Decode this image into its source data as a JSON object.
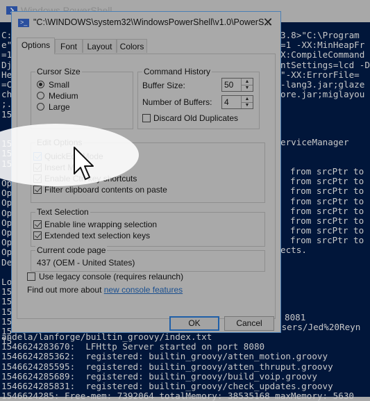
{
  "background_window": {
    "title": "Windows PowerShell",
    "icon": "powershell-icon"
  },
  "console": {
    "left_fragments": [
      "C:",
      "e\"",
      "=1",
      "Dj",
      "He",
      "=C",
      "ch",
      ";.",
      "15",
      "",
      "",
      "15",
      "15",
      "15",
      "",
      "Op",
      "Op",
      "Op",
      "Op",
      "Op",
      "Op",
      "Op",
      "Op",
      "De",
      "",
      "Lo",
      "15",
      "15",
      "15",
      "15",
      "15",
      "15"
    ],
    "right_fragments_top": [
      "3.8>\"C:\\Program",
      "=1 -XX:MinHeapFr",
      "X:CompileCommand",
      "ntSettings=lcd -D",
      "\"-XX:ErrorFile=",
      "-lang3.jar;glaze",
      "ore.jar;miglayou"
    ],
    "right_service": "erviceManager",
    "right_srcptr": [
      "from srcPtr to",
      "from srcPtr to",
      "from srcPtr to",
      "from srcPtr to",
      "from srcPtr to",
      "from srcPtr to",
      "from srcPtr to",
      "from srcPtr to"
    ],
    "right_connects": "ects.",
    "right_port": "8081",
    "right_users": "Users/Jed%20Reyn",
    "bottom_lines": [
      "andela/lanforge/builtin_groovy/index.txt",
      "1546624283670:  LFHttp Server started on port 8080",
      "1546624285362:  registered: builtin_groovy/atten_motion.groovy",
      "1546624285595:  registered: builtin_groovy/atten_thruput.groovy",
      "1546624285689:  registered: builtin_groovy/build_voip.groovy",
      "1546624285831:  registered: builtin_groovy/check_updates.groovy",
      "1546624285: Free-mem: 7392064 totalMemory: 38535168 maxMemory: 5630"
    ]
  },
  "dialog": {
    "title": "\"C:\\WINDOWS\\system32\\WindowsPowerShell\\v1.0\\PowerS...",
    "close_glyph": "✕",
    "tabs": [
      {
        "label": "Options",
        "active": true
      },
      {
        "label": "Font",
        "active": false
      },
      {
        "label": "Layout",
        "active": false
      },
      {
        "label": "Colors",
        "active": false
      }
    ],
    "cursor_size": {
      "label": "Cursor Size",
      "options": [
        {
          "label": "Small",
          "selected": true
        },
        {
          "label": "Medium",
          "selected": false
        },
        {
          "label": "Large",
          "selected": false
        }
      ]
    },
    "command_history": {
      "label": "Command History",
      "buffer_size_label": "Buffer Size:",
      "buffer_size_value": "50",
      "num_buffers_label": "Number of Buffers:",
      "num_buffers_value": "4",
      "discard_label": "Discard Old Duplicates",
      "discard_checked": false
    },
    "edit_options": {
      "label": "Edit Options",
      "items": [
        {
          "label": "QuickEdit Mode",
          "checked": true
        },
        {
          "label": "Insert Mode",
          "checked": true
        },
        {
          "label": "Enable Ctrl key shortcuts",
          "checked": true
        },
        {
          "label": "Filter clipboard contents on paste",
          "checked": true
        }
      ]
    },
    "text_selection": {
      "label": "Text Selection",
      "items": [
        {
          "label": "Enable line wrapping selection",
          "checked": true
        },
        {
          "label": "Extended text selection keys",
          "checked": true
        }
      ]
    },
    "code_page": {
      "label": "Current code page",
      "value": "437   (OEM - United States)"
    },
    "legacy_console": {
      "label": "Use legacy console (requires relaunch)",
      "checked": false
    },
    "find_out_more": "Find out more about ",
    "find_out_link": "new console features",
    "ok_label": "OK",
    "cancel_label": "Cancel",
    "spin_up": "▲",
    "spin_down": "▼"
  },
  "colors": {
    "console_bg": "#01163a",
    "dialog_bg": "#a9a9a9",
    "accent": "#1f5fa8",
    "link": "#1a4f8f"
  }
}
